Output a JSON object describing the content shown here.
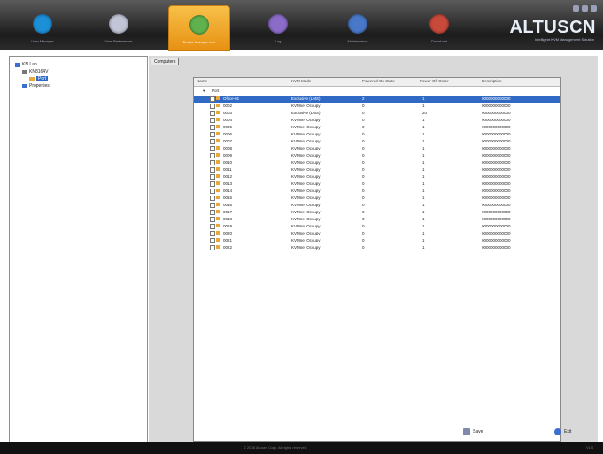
{
  "window": {
    "brand": "ALTUSCN",
    "brand_tagline": "Intelligent KVM Management Solution"
  },
  "top_tabs": [
    {
      "name": "tab-1",
      "label": "User Manager",
      "color": "#1d8fd6"
    },
    {
      "name": "tab-2",
      "label": "User Preferences",
      "color": "#c0c6d6"
    },
    {
      "name": "tab-3",
      "label": "Device Management",
      "color": "#5fb24d",
      "active": true
    },
    {
      "name": "tab-4",
      "label": "Log",
      "color": "#8b6cc9"
    },
    {
      "name": "tab-5",
      "label": "Maintenance",
      "color": "#4a78c8"
    },
    {
      "name": "tab-6",
      "label": "Download",
      "color": "#c84a3a"
    }
  ],
  "tree": {
    "root": "KN Lab",
    "child": "KN8164V",
    "selected": "Port",
    "other": "Properties"
  },
  "computers_tab": "Computers",
  "table": {
    "headers": [
      "Name",
      "KVM Mode",
      "Powered On State",
      "Power Off Order",
      "Description"
    ],
    "group": "Port",
    "rows": [
      {
        "name": "Office-01",
        "mode": "Exclusive (LMS)",
        "state": "2",
        "order": "1",
        "desc": "0000000000000",
        "selected": true
      },
      {
        "name": "0002",
        "mode": "KVMnet Occupy",
        "state": "0",
        "order": "1",
        "desc": "0000000000000"
      },
      {
        "name": "0003",
        "mode": "Exclusive (LMS)",
        "state": "0",
        "order": "20",
        "desc": "0000000000000"
      },
      {
        "name": "0004",
        "mode": "KVMnet Occupy",
        "state": "0",
        "order": "1",
        "desc": "0000000000000"
      },
      {
        "name": "0005",
        "mode": "KVMnet Occupy",
        "state": "0",
        "order": "1",
        "desc": "0000000000000"
      },
      {
        "name": "0006",
        "mode": "KVMnet Occupy",
        "state": "0",
        "order": "1",
        "desc": "0000000000000"
      },
      {
        "name": "0007",
        "mode": "KVMnet Occupy",
        "state": "0",
        "order": "1",
        "desc": "0000000000000"
      },
      {
        "name": "0008",
        "mode": "KVMnet Occupy",
        "state": "0",
        "order": "1",
        "desc": "0000000000000"
      },
      {
        "name": "0009",
        "mode": "KVMnet Occupy",
        "state": "0",
        "order": "1",
        "desc": "0000000000000"
      },
      {
        "name": "0010",
        "mode": "KVMnet Occupy",
        "state": "0",
        "order": "1",
        "desc": "0000000000000"
      },
      {
        "name": "0011",
        "mode": "KVMnet Occupy",
        "state": "0",
        "order": "1",
        "desc": "0000000000000"
      },
      {
        "name": "0012",
        "mode": "KVMnet Occupy",
        "state": "0",
        "order": "1",
        "desc": "0000000000000"
      },
      {
        "name": "0013",
        "mode": "KVMnet Occupy",
        "state": "0",
        "order": "1",
        "desc": "0000000000000"
      },
      {
        "name": "0014",
        "mode": "KVMnet Occupy",
        "state": "0",
        "order": "1",
        "desc": "0000000000000"
      },
      {
        "name": "0015",
        "mode": "KVMnet Occupy",
        "state": "0",
        "order": "1",
        "desc": "0000000000000"
      },
      {
        "name": "0016",
        "mode": "KVMnet Occupy",
        "state": "0",
        "order": "1",
        "desc": "0000000000000"
      },
      {
        "name": "0017",
        "mode": "KVMnet Occupy",
        "state": "0",
        "order": "1",
        "desc": "0000000000000"
      },
      {
        "name": "0018",
        "mode": "KVMnet Occupy",
        "state": "0",
        "order": "1",
        "desc": "0000000000000"
      },
      {
        "name": "0019",
        "mode": "KVMnet Occupy",
        "state": "0",
        "order": "1",
        "desc": "0000000000000"
      },
      {
        "name": "0020",
        "mode": "KVMnet Occupy",
        "state": "0",
        "order": "1",
        "desc": "0000000000000"
      },
      {
        "name": "0021",
        "mode": "KVMnet Occupy",
        "state": "0",
        "order": "1",
        "desc": "0000000000000"
      },
      {
        "name": "0022",
        "mode": "KVMnet Occupy",
        "state": "0",
        "order": "1",
        "desc": "0000000000000"
      }
    ]
  },
  "buttons": {
    "save": "Save",
    "exit": "Exit"
  },
  "status": {
    "copyright": "© 2008 Altusen Corp. All rights reserved.",
    "version": "V1.0"
  }
}
